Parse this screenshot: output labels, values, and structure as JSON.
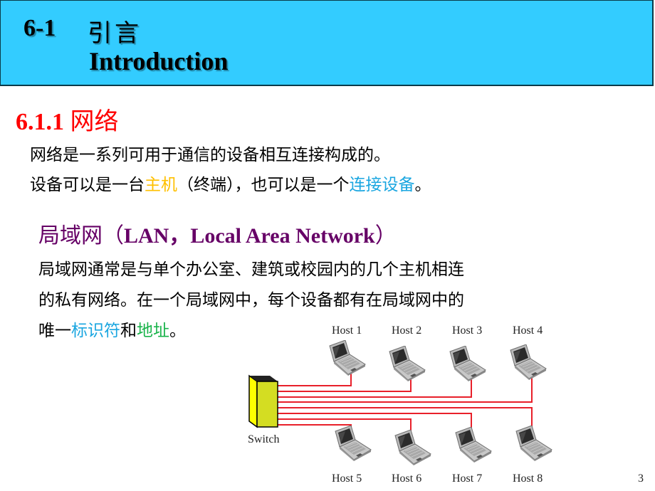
{
  "header": {
    "number": "6-1",
    "title_cn": "引言",
    "title_en": "Introduction",
    "background": "#33ccff"
  },
  "section": {
    "number": "6.1.1",
    "title": "网络",
    "color": "#ff0000"
  },
  "intro": {
    "line1": "网络是一系列可用于通信的设备相互连接构成的。",
    "line2_prefix": "设备可以是一台",
    "line2_host": "主机",
    "line2_mid": "（终端），也可以是一个",
    "line2_device": "连接设备",
    "line2_end": "。"
  },
  "lan": {
    "title_cn": "局域网",
    "title_open": "（",
    "title_en": "LAN，Local Area Network",
    "title_close": "）",
    "title_color": "#660066",
    "line1": "局域网通常是与单个办公室、建筑或校园内的几个主机相连",
    "line2": "的私有网络。在一个局域网中，每个设备都有在局域网中的",
    "line3_prefix": "唯一",
    "line3_identifier": "标识符",
    "line3_and": "和",
    "line3_address": "地址",
    "line3_end": "。"
  },
  "diagram": {
    "switch_label": "Switch",
    "top_hosts": [
      "Host 1",
      "Host 2",
      "Host 3",
      "Host 4"
    ],
    "bottom_hosts": [
      "Host 5",
      "Host 6",
      "Host 7",
      "Host 8"
    ],
    "cable_color": "#e8202a",
    "switch_colors": {
      "front": "#d4dd22",
      "side": "#ffff00",
      "top": "#222222"
    }
  },
  "page_number": "3"
}
